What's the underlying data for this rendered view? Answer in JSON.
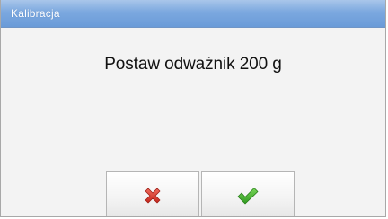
{
  "window": {
    "title": "Kalibracja"
  },
  "dialog": {
    "message": "Postaw odważnik 200 g"
  },
  "buttons": {
    "cancel_icon": "cross-icon",
    "confirm_icon": "checkmark-icon"
  },
  "colors": {
    "titlebar": "#7ba8df",
    "cancel": "#d9362b",
    "confirm": "#3fae2a"
  }
}
